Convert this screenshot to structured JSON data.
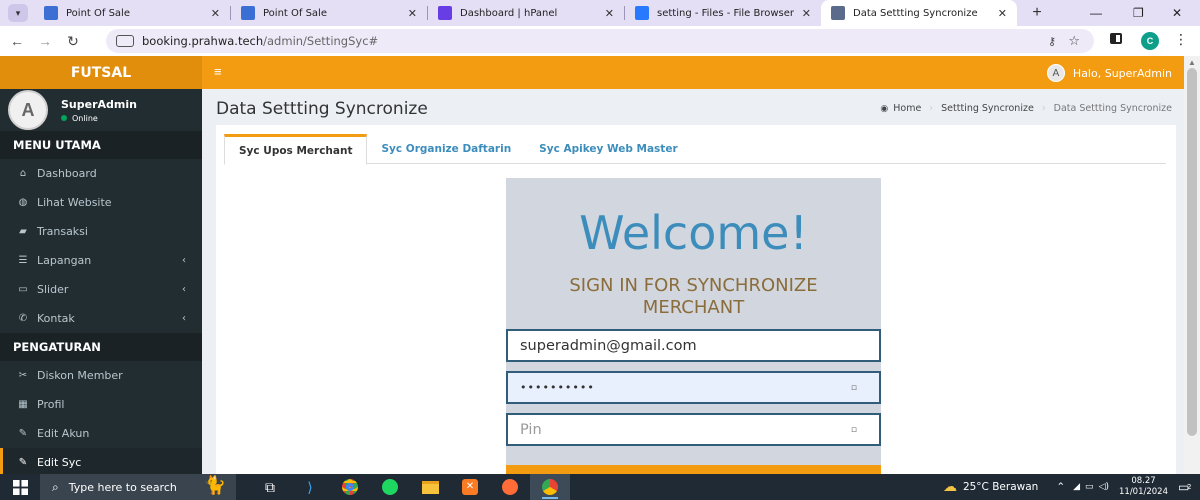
{
  "browser": {
    "tabs": [
      {
        "title": "Point Of Sale",
        "fav": "#3b6fd4",
        "active": false
      },
      {
        "title": "Point Of Sale",
        "fav": "#3b6fd4",
        "active": false
      },
      {
        "title": "Dashboard | hPanel",
        "fav": "#673de6",
        "active": false
      },
      {
        "title": "setting - Files - File Browser",
        "fav": "#2979ff",
        "active": false
      },
      {
        "title": "Data Settting Syncronize",
        "fav": "#5b6b8c",
        "active": true
      }
    ],
    "url_host": "booking.prahwa.tech",
    "url_path": "/admin/SettingSyc#",
    "profile_initial": "C"
  },
  "header": {
    "logo": "FUTSAL",
    "greeting": "Halo, SuperAdmin"
  },
  "sidebar": {
    "user_name": "SuperAdmin",
    "user_status": "Online",
    "section_main": "MENU UTAMA",
    "items_main": [
      {
        "label": "Dashboard",
        "icon": "home-icon",
        "glyph": "⌂",
        "arrow": false
      },
      {
        "label": "Lihat Website",
        "icon": "globe-icon",
        "glyph": "◍",
        "arrow": false
      },
      {
        "label": "Transaksi",
        "icon": "cart-icon",
        "glyph": "▰",
        "arrow": false
      },
      {
        "label": "Lapangan",
        "icon": "list-icon",
        "glyph": "☰",
        "arrow": true
      },
      {
        "label": "Slider",
        "icon": "slider-icon",
        "glyph": "▭",
        "arrow": true
      },
      {
        "label": "Kontak",
        "icon": "phone-icon",
        "glyph": "✆",
        "arrow": true
      }
    ],
    "section_settings": "PENGATURAN",
    "items_settings": [
      {
        "label": "Diskon Member",
        "icon": "scissors-icon",
        "glyph": "✂",
        "active": false
      },
      {
        "label": "Profil",
        "icon": "user-card-icon",
        "glyph": "▦",
        "active": false
      },
      {
        "label": "Edit Akun",
        "icon": "edit-icon",
        "glyph": "✎",
        "active": false
      },
      {
        "label": "Edit Syc",
        "icon": "edit-icon",
        "glyph": "✎",
        "active": true
      }
    ]
  },
  "page": {
    "title": "Data Settting Syncronize",
    "breadcrumb": [
      "Home",
      "Settting Syncronize",
      "Data Settting Syncronize"
    ],
    "tabs": [
      "Syc Upos Merchant",
      "Syc Organize Daftarin",
      "Syc Apikey Web Master"
    ],
    "active_tab": 0
  },
  "login": {
    "welcome": "Welcome!",
    "subtitle": "SIGN IN FOR SYNCHRONIZE MERCHANT",
    "email_value": "superadmin@gmail.com",
    "password_value": "••••••••••",
    "pin_placeholder": "Pin"
  },
  "taskbar": {
    "search_placeholder": "Type here to search",
    "weather": "25°C  Berawan",
    "time": "08.27",
    "date": "11/01/2024",
    "notification_count": "2"
  },
  "colors": {
    "accent_orange": "#f39c12",
    "sidebar_dark": "#222d32",
    "link_blue": "#3c8dbc"
  }
}
